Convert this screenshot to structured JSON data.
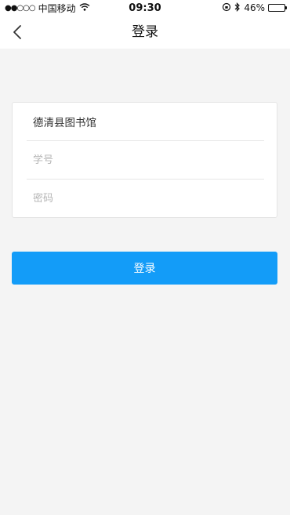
{
  "status_bar": {
    "carrier": "中国移动",
    "time": "09:30",
    "battery": "46%",
    "battery_level": 0.46,
    "icons": [
      "signal-dots-icon",
      "wifi-icon",
      "orientation-lock-icon",
      "bluetooth-icon",
      "battery-icon"
    ]
  },
  "nav": {
    "title": "登录",
    "back_icon": "chevron-left-icon"
  },
  "form": {
    "library": "德清县图书馆",
    "student_id_placeholder": "学号",
    "password_placeholder": "密码"
  },
  "login_button": "登录",
  "colors": {
    "accent": "#139cf8",
    "background": "#f4f4f4",
    "card": "#ffffff"
  }
}
